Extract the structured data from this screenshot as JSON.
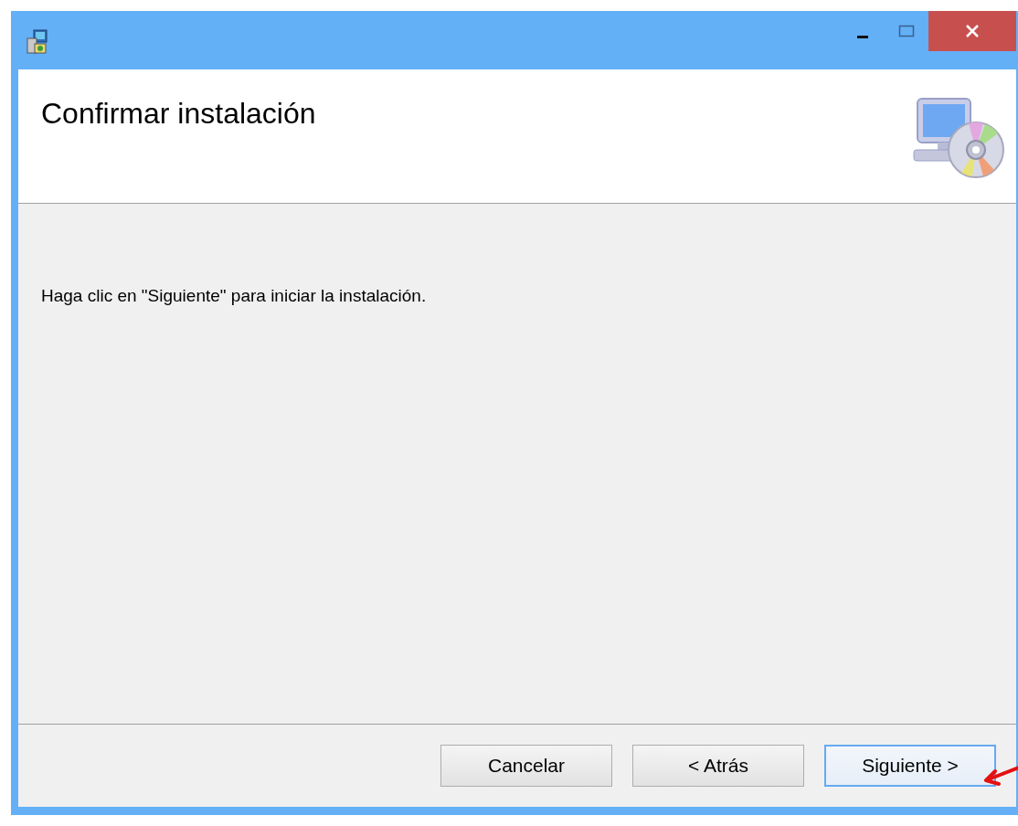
{
  "window": {
    "controls": [
      {
        "kind": "minimize"
      },
      {
        "kind": "maximize"
      },
      {
        "kind": "close"
      }
    ]
  },
  "header": {
    "title": "Confirmar instalación"
  },
  "body": {
    "message": "Haga clic en \"Siguiente\" para iniciar la instalación."
  },
  "buttons": [
    {
      "label": "Cancelar",
      "focused": false
    },
    {
      "label": "< Atrás",
      "focused": false
    },
    {
      "label": "Siguiente >",
      "focused": true
    }
  ]
}
